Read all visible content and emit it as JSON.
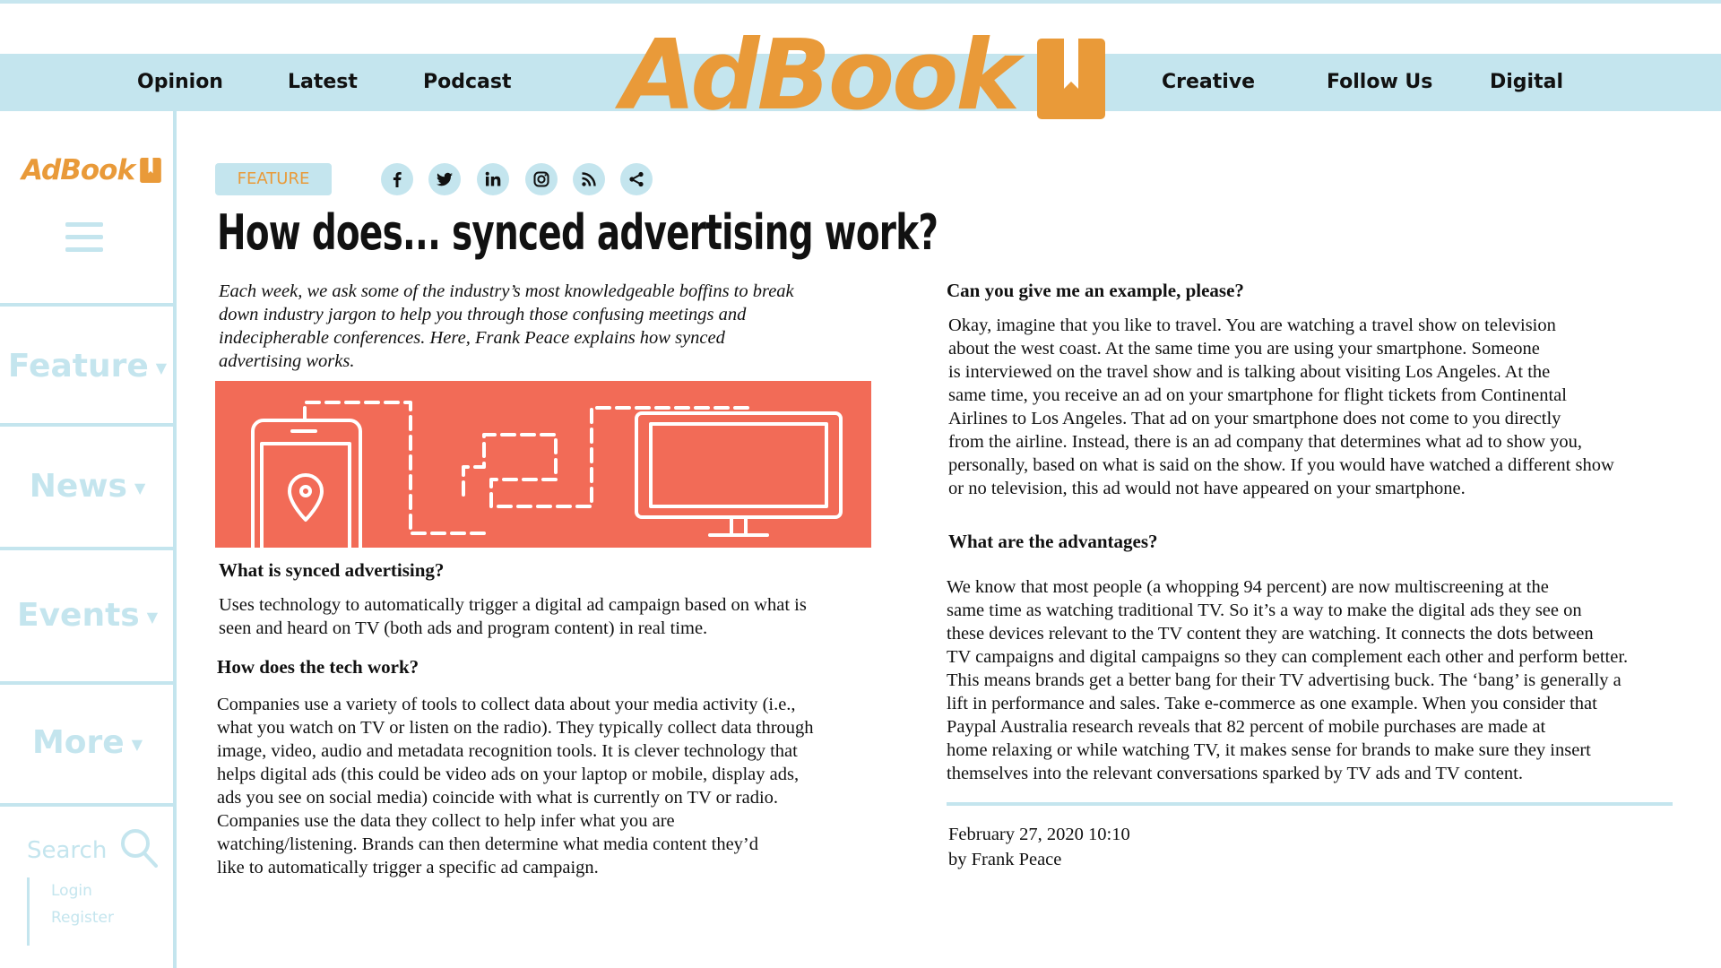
{
  "brand": {
    "name": "AdBook",
    "accent_color": "#e99a39",
    "light_blue": "#c4e5ee",
    "hero_color": "#f26b57"
  },
  "top_nav": {
    "left_items": [
      "Opinion",
      "Latest",
      "Podcast"
    ],
    "right_items": [
      "Creative",
      "Follow Us",
      "Digital"
    ]
  },
  "sidebar": {
    "logo_text": "AdBook",
    "menu": [
      {
        "label": "Feature",
        "icon": "caret-down-icon"
      },
      {
        "label": "News",
        "icon": "caret-down-icon"
      },
      {
        "label": "Events",
        "icon": "caret-down-icon"
      },
      {
        "label": "More",
        "icon": "caret-down-icon"
      }
    ],
    "search_label": "Search",
    "login_label": "Login",
    "register_label": "Register"
  },
  "article": {
    "badge": "FEATURE",
    "social_icons": [
      "facebook-icon",
      "twitter-icon",
      "linkedin-icon",
      "instagram-icon",
      "rss-icon",
      "share-icon"
    ],
    "headline": "How does... synced advertising work?",
    "intro": [
      "Each week, we ask some of the industry’s most knowledgeable boffins to break",
      "down industry jargon to help you through those confusing meetings and",
      "indecipherable conferences. Here, Frank Peace explains how synced",
      "advertising works."
    ],
    "sections": [
      {
        "heading": "What is synced advertising?",
        "lines": [
          "Uses technology to automatically trigger a digital ad campaign based on what is",
          "seen and heard on TV (both ads and program content) in real time."
        ]
      },
      {
        "heading": "How does the tech work?",
        "lines": [
          "Companies use a variety of tools to collect data about your media activity (i.e.,",
          "what you watch on TV or listen on the radio). They typically collect data through",
          "image, video, audio and metadata recognition tools. It is clever technology that",
          "helps digital ads (this could be video ads on your laptop or mobile, display ads,",
          "ads you see on social media) coincide with what is currently on TV or radio.",
          "Companies use the data they collect to help infer what you are",
          "watching/listening. Brands can then determine what media content they’d",
          "like to automatically trigger a specific ad campaign."
        ]
      },
      {
        "heading": "Can you give me an example, please?",
        "lines": [
          "Okay, imagine that you like to travel. You are watching a travel show on television",
          "about the west coast. At the same time you are using your smartphone. Someone",
          "is interviewed on the travel show and is talking about visiting Los Angeles. At the",
          "same time, you receive an ad on your smartphone for flight tickets from Continental",
          "Airlines to Los Angeles. That ad on your smartphone does not come to you directly",
          "from the airline. Instead, there is an ad company that determines what ad to show you,",
          "personally, based on what is said on the show. If you would have watched a different show",
          "or no television, this ad would not have appeared on your smartphone."
        ]
      },
      {
        "heading": "What are the advantages?",
        "lines": [
          "We know that most people (a whopping 94 percent) are now multiscreening at the",
          "same time as watching traditional TV. So it’s a way to make the digital ads they see on",
          "these devices relevant to the TV content they are watching. It connects the dots between",
          "TV campaigns and digital campaigns so they can complement each other and perform better.",
          "This means brands get a better bang for their TV advertising buck. The ‘bang’ is generally a",
          "lift in performance and sales. Take e-commerce as one example. When you consider that",
          "Paypal Australia research reveals that 82 percent of mobile purchases are made at",
          "home relaxing or while watching TV, it makes sense for brands to make sure they insert",
          "themselves into the relevant conversations sparked by TV ads and TV content."
        ]
      }
    ],
    "date": "February 27, 2020 10:10",
    "byline": "by Frank Peace"
  }
}
